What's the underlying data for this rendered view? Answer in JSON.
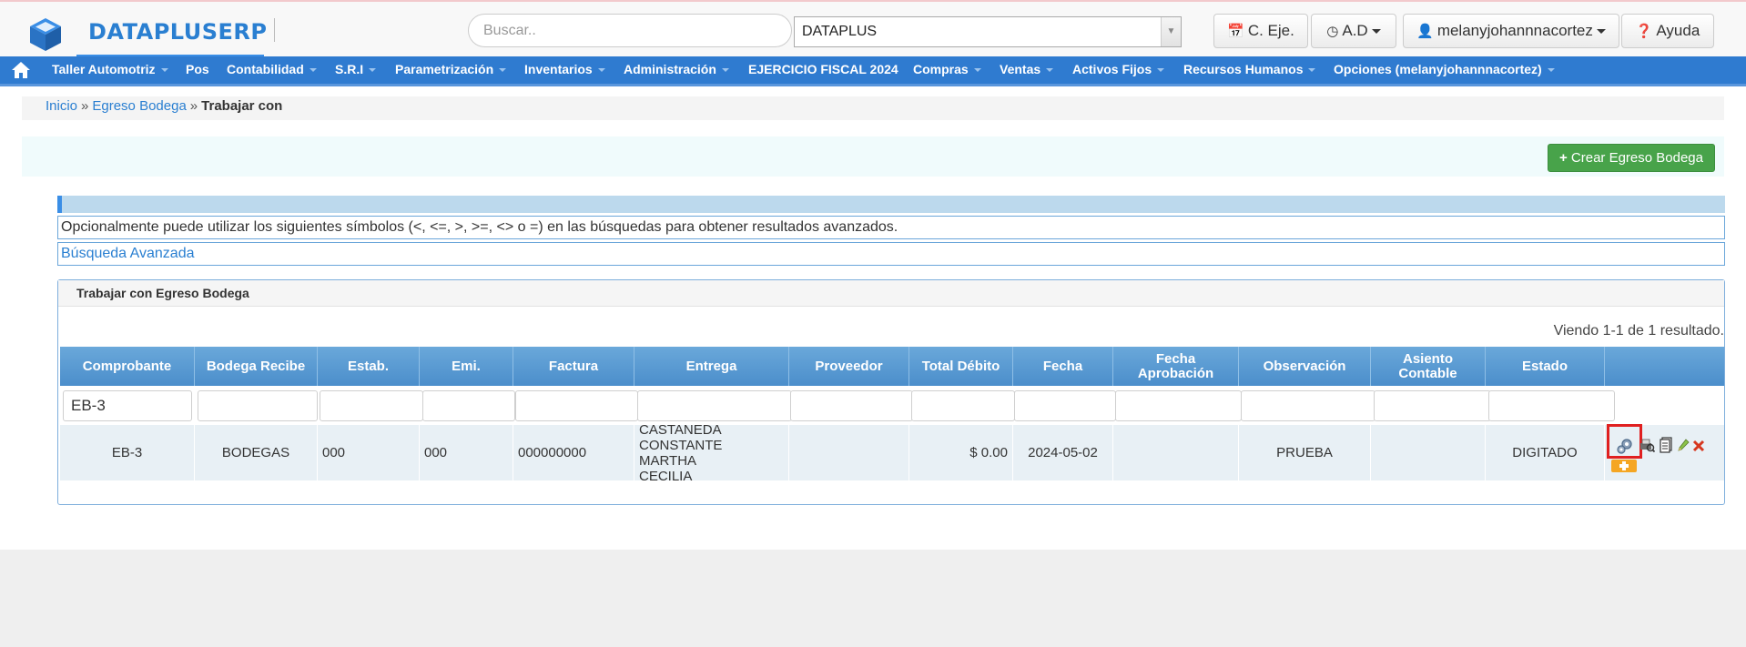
{
  "header": {
    "brand": "DATAPLUSERP",
    "search_placeholder": "Buscar..",
    "company": "DATAPLUS",
    "buttons": {
      "ejercicio": "C. Eje.",
      "ad": "A.D",
      "user": "melanyjohannnacortez",
      "help": "Ayuda"
    }
  },
  "menu": [
    {
      "label": "Taller Automotriz"
    },
    {
      "label": "Pos"
    },
    {
      "label": "Contabilidad"
    },
    {
      "label": "S.R.I"
    },
    {
      "label": "Parametrización"
    },
    {
      "label": "Inventarios"
    },
    {
      "label": "Administración"
    },
    {
      "label": "EJERCICIO FISCAL 2024"
    },
    {
      "label": "Compras"
    },
    {
      "label": "Ventas"
    },
    {
      "label": "Activos Fijos"
    },
    {
      "label": "Recursos Humanos"
    },
    {
      "label": "Opciones (melanyjohannnacortez)"
    }
  ],
  "breadcrumb": {
    "home": "Inicio",
    "section": "Egreso Bodega",
    "current": "Trabajar con",
    "separator": "»"
  },
  "actions": {
    "create_label": "Crear Egreso Bodega"
  },
  "info": {
    "symbols_hint": "Opcionalmente puede utilizar los siguientes símbolos (<, <=, >, >=, <> o =) en las búsquedas para obtener resultados avanzados.",
    "advanced_search": "Búsqueda Avanzada"
  },
  "panel": {
    "title": "Trabajar con Egreso Bodega",
    "results": "Viendo 1-1 de 1 resultado."
  },
  "table": {
    "columns": [
      {
        "label": "Comprobante",
        "filter": "EB-3"
      },
      {
        "label": "Bodega Recibe",
        "filter": ""
      },
      {
        "label": "Estab.",
        "filter": ""
      },
      {
        "label": "Emi.",
        "filter": ""
      },
      {
        "label": "Factura",
        "filter": ""
      },
      {
        "label": "Entrega",
        "filter": ""
      },
      {
        "label": "Proveedor",
        "filter": ""
      },
      {
        "label": "Total Débito",
        "filter": ""
      },
      {
        "label": "Fecha",
        "filter": ""
      },
      {
        "label": "Fecha Aprobación",
        "filter": ""
      },
      {
        "label": "Observación",
        "filter": ""
      },
      {
        "label": "Asiento Contable",
        "filter": ""
      },
      {
        "label": "Estado",
        "filter": ""
      },
      {
        "label": "",
        "filter": ""
      }
    ],
    "rows": [
      {
        "cells": [
          "EB-3",
          "BODEGAS",
          "000",
          "000",
          "000000000",
          "CASTANEDA CONSTANTE MARTHA CECILIA",
          "",
          "$ 0.00",
          "2024-05-02",
          "",
          "PRUEBA",
          "",
          "DIGITADO"
        ],
        "actions": [
          "generate-icon",
          "search-print-icon",
          "document-icon",
          "edit-icon",
          "delete-icon",
          "add-icon"
        ]
      }
    ]
  },
  "colors": {
    "menu_bg": "#2f7bd0",
    "brand": "#2a7fd1",
    "create_button": "#48a34a",
    "table_header": "#4b8ecb",
    "highlight": "#e02020"
  }
}
